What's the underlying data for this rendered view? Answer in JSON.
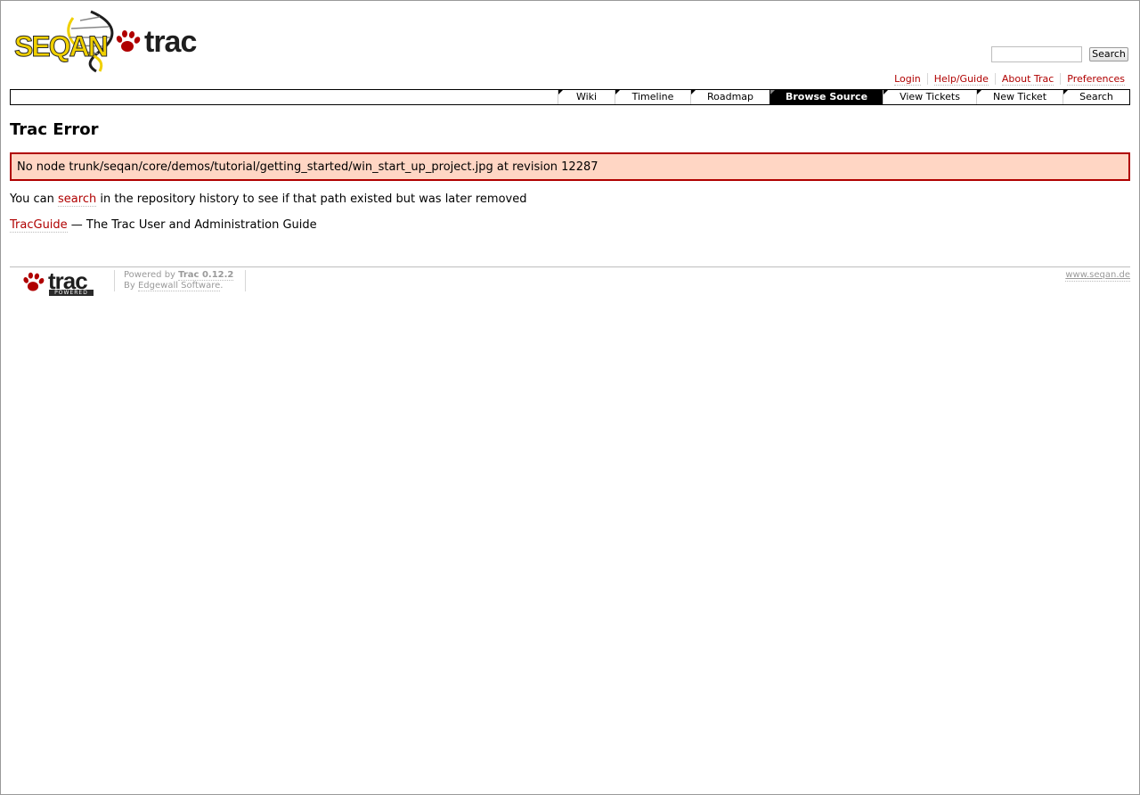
{
  "logo": {
    "brand_text": "SEQAN",
    "product_text": "trac",
    "icon": "paw-icon",
    "brand_colors": {
      "yellow": "#f0d000",
      "dark": "#1e1e1e",
      "paw_red": "#b00000"
    }
  },
  "search": {
    "placeholder": "",
    "value": "",
    "button_label": "Search"
  },
  "metanav": {
    "items": [
      {
        "label": "Login"
      },
      {
        "label": "Help/Guide"
      },
      {
        "label": "About Trac"
      },
      {
        "label": "Preferences"
      }
    ]
  },
  "mainnav": {
    "tabs": [
      {
        "label": "Wiki"
      },
      {
        "label": "Timeline"
      },
      {
        "label": "Roadmap"
      },
      {
        "label": "Browse Source"
      },
      {
        "label": "View Tickets"
      },
      {
        "label": "New Ticket"
      },
      {
        "label": "Search"
      }
    ],
    "active_tab": "Browse Source"
  },
  "content": {
    "title": "Trac Error",
    "error_message": "No node trunk/seqan/core/demos/tutorial/getting_started/win_start_up_project.jpg at revision 12287",
    "search_hint": {
      "prefix": "You can ",
      "link": "search",
      "suffix": " in the repository history to see if that path existed but was later removed"
    },
    "guide": {
      "link": "TracGuide",
      "suffix": " — The Trac User and Administration Guide"
    },
    "colors": {
      "link": "#b00000",
      "error_border": "#b00000",
      "error_bg": "#ffd6c4"
    }
  },
  "footer": {
    "logo_text": "trac",
    "powered_badge": "POWERED",
    "powered_by_prefix": "Powered by ",
    "trac_version": "Trac 0.12.2",
    "by_prefix": "By ",
    "vendor": "Edgewall Software",
    "vendor_suffix": ".",
    "right_link": "www.seqan.de"
  }
}
